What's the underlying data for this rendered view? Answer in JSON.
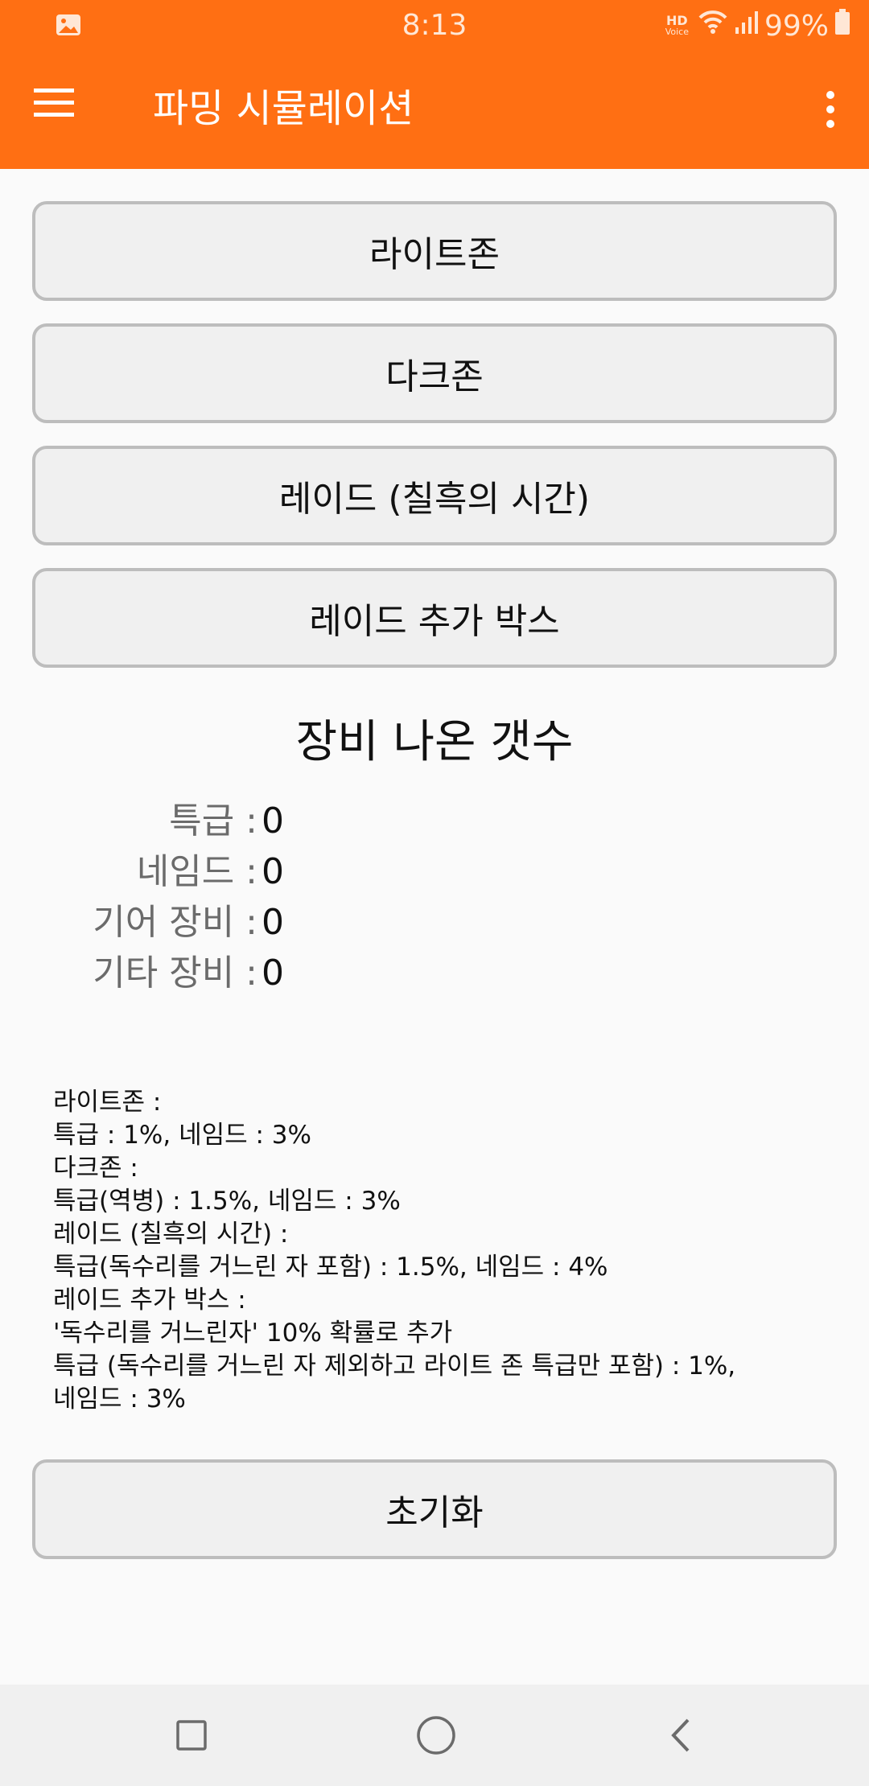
{
  "status_bar": {
    "time": "8:13",
    "battery": "99%",
    "hd_label": "HD",
    "voice_label": "Voice"
  },
  "app_bar": {
    "title": "파밍 시뮬레이션"
  },
  "buttons": {
    "light_zone": "라이트존",
    "dark_zone": "다크존",
    "raid": "레이드 (칠흑의 시간)",
    "raid_extra_box": "레이드 추가 박스",
    "reset": "초기화"
  },
  "equipment_counts": {
    "title": "장비 나온 갯수",
    "rows": [
      {
        "label": "특급 :",
        "value": "0"
      },
      {
        "label": "네임드 :",
        "value": "0"
      },
      {
        "label": "기어 장비 :",
        "value": "0"
      },
      {
        "label": "기타 장비 :",
        "value": "0"
      }
    ]
  },
  "drop_rates": {
    "lines": [
      "라이트존 :",
      "특급 : 1%, 네임드 : 3%",
      "다크존 :",
      "특급(역병) : 1.5%, 네임드 : 3%",
      "레이드 (칠흑의 시간) :",
      "특급(독수리를 거느린 자 포함) : 1.5%, 네임드 : 4%",
      "레이드 추가 박스 :",
      "'독수리를 거느린자' 10% 확률로 추가",
      "특급 (독수리를 거느린 자 제외하고 라이트 존 특급만 포함) : 1%,",
      "네임드 : 3%"
    ]
  },
  "colors": {
    "app_bar": "#ff6f13",
    "background": "#fafafa",
    "button_bg": "#f0f0f0",
    "button_border": "#bdbdbd"
  }
}
